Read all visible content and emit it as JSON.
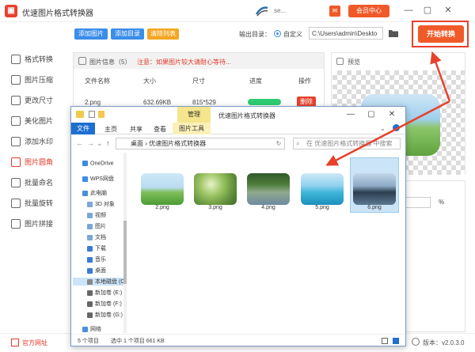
{
  "app": {
    "title": "优速图片格式转换器",
    "user_name": "se...",
    "vip_label": "会员中心",
    "min": "—",
    "restore": "▢",
    "close": "✕"
  },
  "sidebar": {
    "items": [
      {
        "label": "格式转换"
      },
      {
        "label": "图片压缩"
      },
      {
        "label": "更改尺寸"
      },
      {
        "label": "美化图片"
      },
      {
        "label": "添加水印"
      },
      {
        "label": "图片圆角"
      },
      {
        "label": "批量命名"
      },
      {
        "label": "批量旋转"
      },
      {
        "label": "图片拼接"
      }
    ]
  },
  "toolbar": {
    "add_image": "添加图片",
    "add_folder": "添加目录",
    "clear_list": "清除列表",
    "output_dir_label": "输出目录：",
    "custom_label": "自定义",
    "path_value": "C:\\Users\\admin\\Deskto",
    "start_label": "开始转换"
  },
  "list": {
    "info_title": "图片信息（5）",
    "info_note": "注意：如果图片较大请耐心等待...",
    "columns": [
      "文件名称",
      "大小",
      "尺寸",
      "进度",
      "操作"
    ],
    "rows": [
      {
        "name": "2.png",
        "size": "632.69KB",
        "dims": "815*529",
        "progress": 1.0,
        "action": "删除"
      }
    ]
  },
  "preview": {
    "label": "预览",
    "percent_unit": "%"
  },
  "bottom": {
    "home_link": "官方网址",
    "version": "版本：v2.0.3.0"
  },
  "explorer": {
    "tools_tab": "管理",
    "title": "优速图片格式转换器",
    "ribbon": {
      "file": "文件",
      "home": "主页",
      "share": "共享",
      "view": "查看",
      "image_tools": "图片工具"
    },
    "address": "桌面 › 优速图片格式转换器",
    "search_placeholder": "在 优速图片格式转换器 中搜索",
    "nav": [
      {
        "label": "OneDrive"
      },
      {
        "label": "WPS网盘"
      },
      {
        "label": "此电脑"
      },
      {
        "label": "3D 对象"
      },
      {
        "label": "视频"
      },
      {
        "label": "图片"
      },
      {
        "label": "文档"
      },
      {
        "label": "下载"
      },
      {
        "label": "音乐"
      },
      {
        "label": "桌面"
      },
      {
        "label": "本地磁盘 (C:"
      },
      {
        "label": "新加卷 (E:)"
      },
      {
        "label": "新加卷 (F:)"
      },
      {
        "label": "新加卷 (G:)"
      },
      {
        "label": "网络"
      }
    ],
    "files": [
      {
        "name": "2.png"
      },
      {
        "name": "3.png"
      },
      {
        "name": "4.png"
      },
      {
        "name": "5.png"
      },
      {
        "name": "6.png"
      }
    ],
    "status": {
      "count": "5 个项目",
      "selected": "选中 1 个项目  661 KB"
    }
  },
  "colors": {
    "accent_red": "#e8412c",
    "blue_btn": "#3b8de8",
    "orange_btn": "#f5a623",
    "progress_green": "#2ecc71"
  }
}
